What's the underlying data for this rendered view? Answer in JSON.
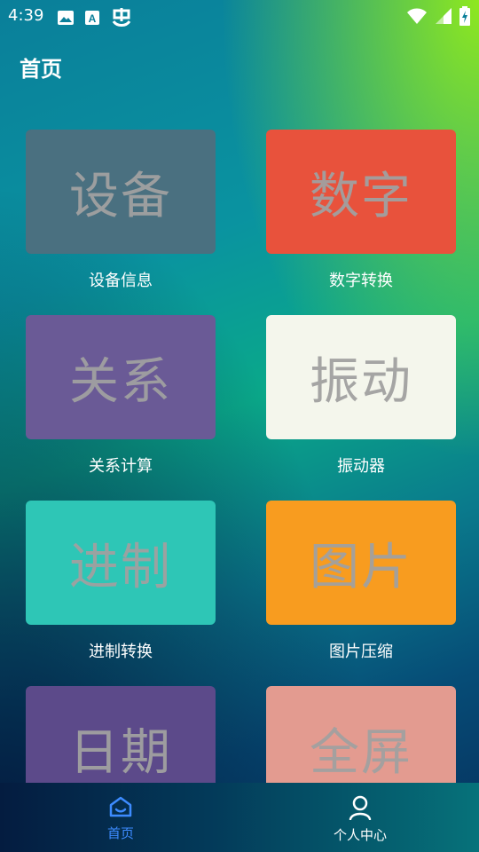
{
  "status_bar": {
    "time": "4:39",
    "icons_left": [
      "image-icon",
      "keyboard-a-icon",
      "app-glyph-icon"
    ],
    "icons_right": [
      "wifi-icon",
      "signal-icon",
      "battery-charging-icon"
    ]
  },
  "header": {
    "title": "首页"
  },
  "tiles": [
    {
      "card_text": "设备",
      "caption": "设备信息",
      "color": "#4a7080"
    },
    {
      "card_text": "数字",
      "caption": "数字转换",
      "color": "#e8523c"
    },
    {
      "card_text": "关系",
      "caption": "关系计算",
      "color": "#6a5a96"
    },
    {
      "card_text": "振动",
      "caption": "振动器",
      "color": "#f4f6ec"
    },
    {
      "card_text": "进制",
      "caption": "进制转换",
      "color": "#2ec6b6"
    },
    {
      "card_text": "图片",
      "caption": "图片压缩",
      "color": "#f89c1f"
    },
    {
      "card_text": "日期",
      "caption": "",
      "color": "#5c4a8a"
    },
    {
      "card_text": "全屏",
      "caption": "",
      "color": "#e39b90"
    }
  ],
  "tab_bar": {
    "home_label": "首页",
    "profile_label": "个人中心",
    "active_color": "#3d8bff",
    "inactive_color": "#ffffff"
  }
}
